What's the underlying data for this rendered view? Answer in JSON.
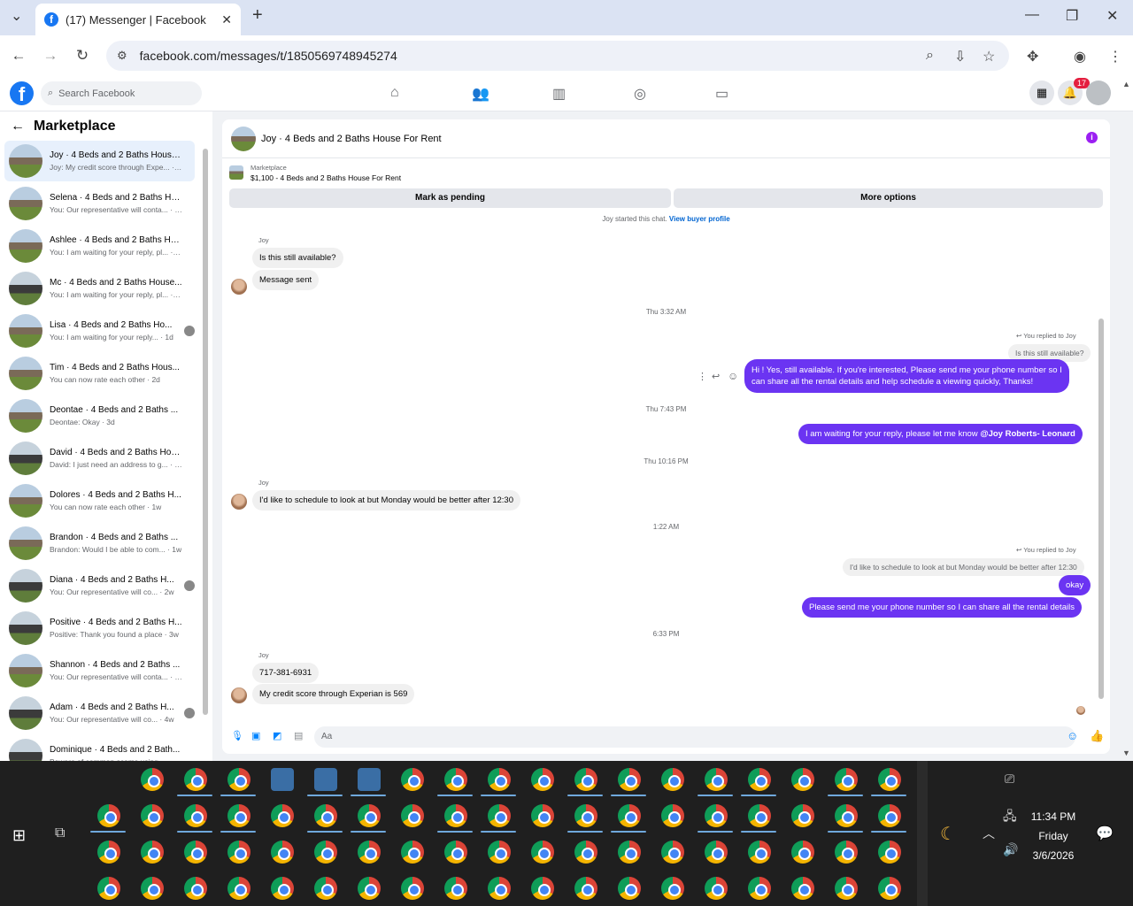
{
  "browser": {
    "tab_title": "(17) Messenger | Facebook",
    "url": "facebook.com/messages/t/1850569748945274"
  },
  "fb": {
    "search_placeholder": "Search Facebook",
    "notification_count": "17"
  },
  "sidebar": {
    "title": "Marketplace",
    "conversations": [
      {
        "name": "Joy · 4 Beds and 2 Baths House...",
        "preview": "Joy: My credit score through Expe... · 5h",
        "active": true
      },
      {
        "name": "Selena · 4 Beds and 2 Baths Ho...",
        "preview": "You: Our representative will conta... · 8h"
      },
      {
        "name": "Ashlee · 4 Beds and 2 Baths Ho...",
        "preview": "You: I am waiting for your reply, pl... · 1d"
      },
      {
        "name": "Mc · 4 Beds and 2 Baths House...",
        "preview": "You: I am waiting for your reply, pl... · 1d"
      },
      {
        "name": "Lisa · 4 Beds and 2 Baths Ho...",
        "preview": "You: I am waiting for your reply... · 1d"
      },
      {
        "name": "Tim · 4 Beds and 2 Baths Hous...",
        "preview": "You can now rate each other · 2d"
      },
      {
        "name": "Deontae · 4 Beds and 2 Baths ...",
        "preview": "Deontae: Okay · 3d"
      },
      {
        "name": "David · 4 Beds and 2 Baths Hou...",
        "preview": "David: I just need an address to g... · 6d"
      },
      {
        "name": "Dolores · 4 Beds and 2 Baths H...",
        "preview": "You can now rate each other · 1w"
      },
      {
        "name": "Brandon · 4 Beds and 2 Baths ...",
        "preview": "Brandon: Would I be able to com... · 1w"
      },
      {
        "name": "Diana · 4 Beds and 2 Baths H...",
        "preview": "You: Our representative will co... · 2w"
      },
      {
        "name": "Positive · 4 Beds and 2 Baths H...",
        "preview": "Positive: Thank you found a place · 3w"
      },
      {
        "name": "Shannon · 4 Beds and 2 Baths ...",
        "preview": "You: Our representative will conta... · 3w"
      },
      {
        "name": "Adam · 4 Beds and 2 Baths H...",
        "preview": "You: Our representative will co... · 4w"
      },
      {
        "name": "Dominique · 4 Beds and 2 Bath...",
        "preview": "Beware of common scams using ... · 5w"
      }
    ]
  },
  "chat": {
    "header_name": "Joy · 4 Beds and 2 Baths House For Rent",
    "marketplace_label": "Marketplace",
    "listing": "$1,100 - 4 Beds and 2 Baths House For Rent",
    "mark_pending": "Mark as pending",
    "more_options": "More options",
    "started": "Joy started this chat.",
    "view_buyer": "View buyer profile",
    "sender_joy": "Joy",
    "m1": "Is this still available?",
    "m2": "Message sent",
    "ts1": "Thu 3:32 AM",
    "replied": "You replied to Joy",
    "q1": "Is this still available?",
    "m3a": "Hi ! Yes, still available. If you're interested, Please send me your phone number so I",
    "m3b": "can share all the rental details and help schedule a viewing quickly, Thanks!",
    "ts2": "Thu 7:43 PM",
    "m4": "I am waiting for your reply, please let me know",
    "m4_mention": "@Joy Roberts- Leonard",
    "ts3": "Thu 10:16 PM",
    "m5": "I'd like to schedule to look at but Monday would be better after 12:30",
    "ts4": "1:22 AM",
    "q2": "I'd like to schedule to look at but Monday would be better after 12:30",
    "m6": "okay",
    "m7": "Please send me your phone number so I can share all the rental details",
    "ts5": "6:33 PM",
    "m8": "717-381-6931",
    "m9": "My credit score through Experian is 569",
    "composer_placeholder": "Aa"
  },
  "taskbar": {
    "time": "11:34 PM",
    "day": "Friday",
    "date": "3/6/2026"
  }
}
